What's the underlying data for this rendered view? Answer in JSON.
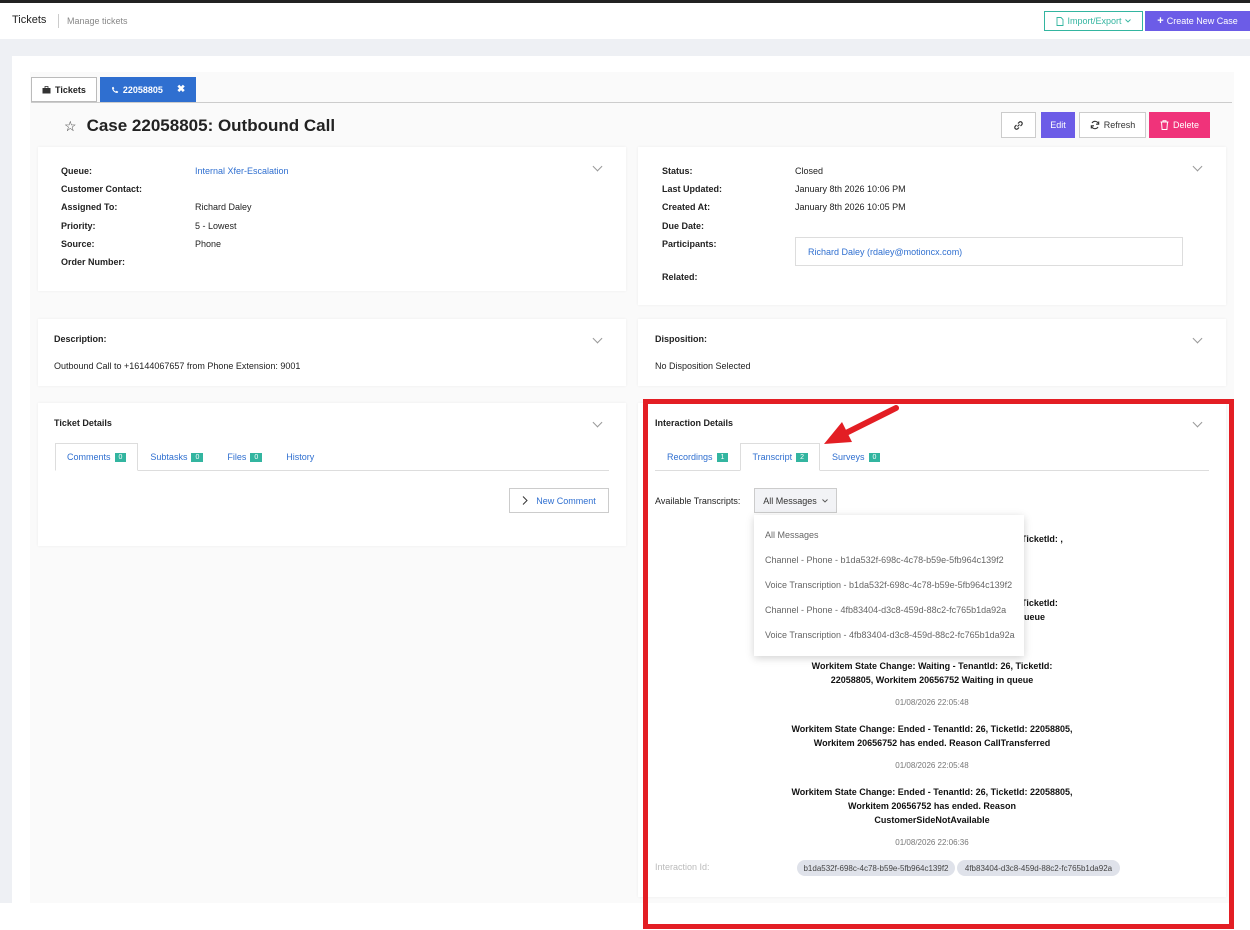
{
  "header": {
    "title": "Tickets",
    "subtitle": "Manage tickets",
    "import_export_label": "Import/Export",
    "create_label": "Create New Case"
  },
  "tabs": {
    "tickets_label": "Tickets",
    "case_label": "22058805"
  },
  "case": {
    "title": "Case 22058805: Outbound Call",
    "actions": {
      "edit": "Edit",
      "refresh": "Refresh",
      "delete": "Delete"
    }
  },
  "left_info": {
    "queue_label": "Queue:",
    "queue_value": "Internal Xfer-Escalation",
    "contact_label": "Customer Contact:",
    "assigned_label": "Assigned To:",
    "assigned_value": "Richard Daley",
    "priority_label": "Priority:",
    "priority_value": "5 - Lowest",
    "source_label": "Source:",
    "source_value": "Phone",
    "order_label": "Order Number:"
  },
  "right_info": {
    "status_label": "Status:",
    "status_value": "Closed",
    "updated_label": "Last Updated:",
    "updated_value": "January 8th 2026 10:06 PM",
    "created_label": "Created At:",
    "created_value": "January 8th 2026 10:05 PM",
    "due_label": "Due Date:",
    "participants_label": "Participants:",
    "participant_value": "Richard Daley (rdaley@motioncx.com)",
    "related_label": "Related:"
  },
  "description": {
    "heading": "Description:",
    "text": "Outbound Call to +16144067657 from Phone Extension: 9001"
  },
  "disposition": {
    "heading": "Disposition:",
    "text": "No Disposition Selected"
  },
  "ticket_details": {
    "heading": "Ticket Details",
    "tabs": [
      {
        "label": "Comments",
        "count": "0"
      },
      {
        "label": "Subtasks",
        "count": "0"
      },
      {
        "label": "Files",
        "count": "0"
      },
      {
        "label": "History"
      }
    ],
    "new_comment_label": "New Comment"
  },
  "interaction": {
    "heading": "Interaction Details",
    "tabs": [
      {
        "label": "Recordings",
        "count": "1"
      },
      {
        "label": "Transcript",
        "count": "2"
      },
      {
        "label": "Surveys",
        "count": "0"
      }
    ],
    "available_label": "Available Transcripts:",
    "selected_transcript": "All Messages",
    "transcript_options": [
      "All Messages",
      "Channel - Phone - b1da532f-698c-4c78-b59e-5fb964c139f2",
      "Voice Transcription - b1da532f-698c-4c78-b59e-5fb964c139f2",
      "Channel - Phone - 4fb83404-d3c8-459d-88c2-fc765b1da92a",
      "Voice Transcription - 4fb83404-d3c8-459d-88c2-fc765b1da92a"
    ],
    "partial_fragments": [
      "TicketId: ,",
      "TicketId:",
      "ueue"
    ],
    "messages": [
      {
        "line1": "Workitem State Change: Waiting - TenantId: 26, TicketId:",
        "line2": "22058805, Workitem 20656752 Waiting in queue",
        "line3": "",
        "time": "01/08/2026 22:05:48"
      },
      {
        "line1": "Workitem State Change: Ended - TenantId: 26, TicketId: 22058805,",
        "line2": "Workitem 20656752 has ended. Reason CallTransferred",
        "line3": "",
        "time": "01/08/2026 22:05:48"
      },
      {
        "line1": "Workitem State Change: Ended - TenantId: 26, TicketId: 22058805,",
        "line2": "Workitem 20656752 has ended. Reason",
        "line3": "CustomerSideNotAvailable",
        "time": "01/08/2026 22:06:36"
      }
    ],
    "interaction_id_label": "Interaction Id:",
    "interaction_ids": [
      "b1da532f-698c-4c78-b59e-5fb964c139f2",
      "4fb83404-d3c8-459d-88c2-fc765b1da92a"
    ]
  },
  "colors": {
    "primary": "#2f6fd0",
    "accent_purple": "#6c5ce7",
    "teal": "#33b5a0",
    "delete_pink": "#f0337a",
    "annotation_red": "#e31e24"
  },
  "icons": [
    "file-icon",
    "plus-icon",
    "briefcase-icon",
    "phone-icon",
    "close-icon",
    "star-icon",
    "link-icon",
    "refresh-icon",
    "trash-icon",
    "chevron-down-icon",
    "chevron-right-icon",
    "arrow-annotation"
  ]
}
